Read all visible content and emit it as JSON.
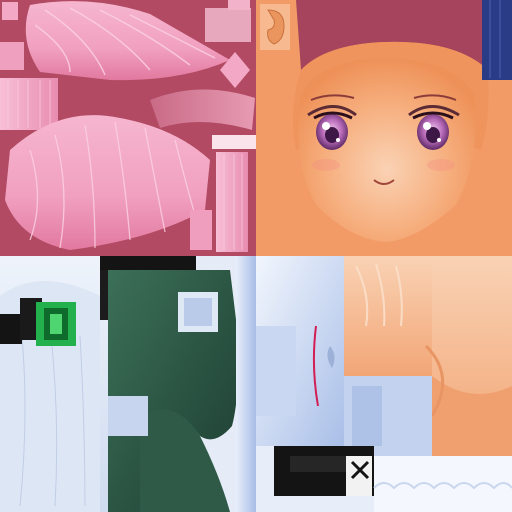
{
  "atlas": {
    "regions": [
      {
        "id": "hair",
        "icon": "hair-strands"
      },
      {
        "id": "face",
        "icon": "anime-face"
      },
      {
        "id": "clothing",
        "icon": "dress-fabric"
      },
      {
        "id": "skin-and-accessories",
        "icon": "skin-panels"
      }
    ]
  },
  "palette": {
    "hair_bg": "#b24a63",
    "hair_pink": "#f3a8c6",
    "hair_pink_light": "#fbd0e2",
    "hair_pink_dark": "#d2678f",
    "face_orange": "#f29b66",
    "face_orange_light": "#f8c09a",
    "face_border": "#a5445c",
    "eye_purple": "#8a3f8d",
    "eye_iris_light": "#d79ad6",
    "cloth_white": "#dfe8f5",
    "cloth_blue": "#b8c9ea",
    "cloth_green": "#2f5a47",
    "cloth_green_dark": "#1f3d31",
    "accent_green": "#22b14c",
    "black": "#141414",
    "skin": "#f5b58a",
    "skin_light": "#f9cfb0",
    "hair_navy": "#2b3c86"
  }
}
